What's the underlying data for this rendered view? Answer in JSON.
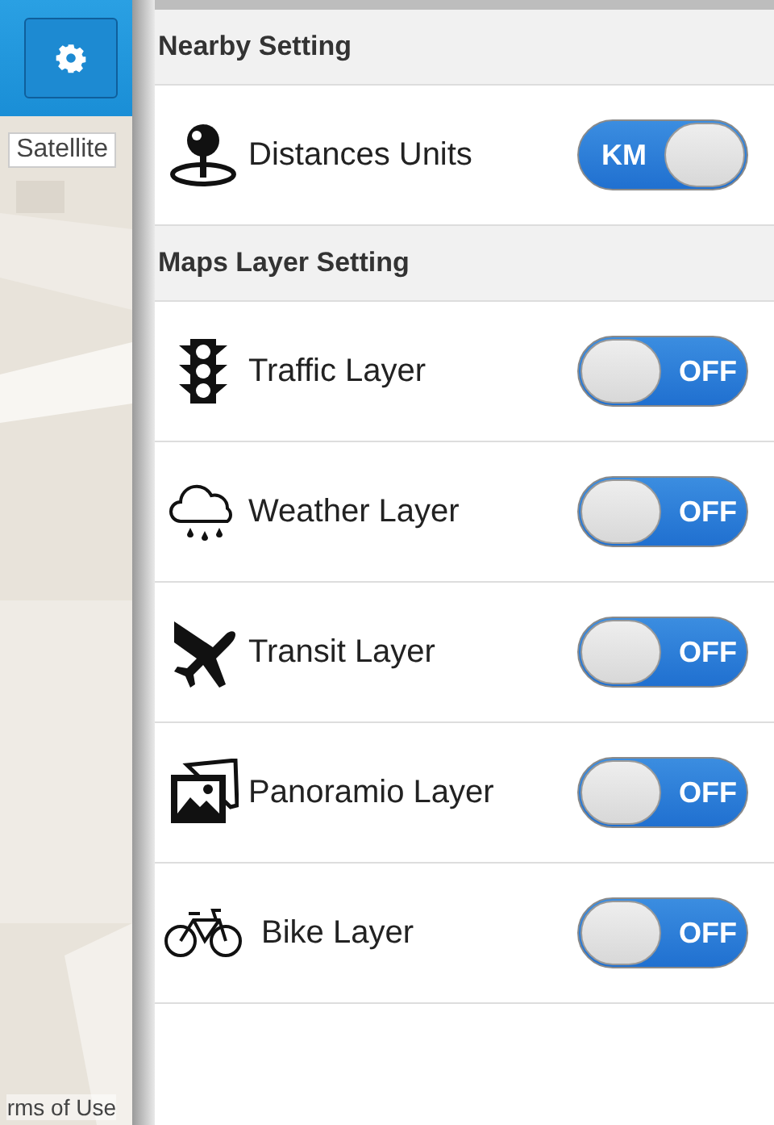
{
  "map": {
    "satellite_button": "Satellite",
    "terms_link": "rms of Use"
  },
  "sections": [
    {
      "title": "Nearby Setting",
      "rows": [
        {
          "label": "Distances Units",
          "toggle": {
            "on": true,
            "text": "KM"
          }
        }
      ]
    },
    {
      "title": "Maps Layer Setting",
      "rows": [
        {
          "label": "Traffic Layer",
          "toggle": {
            "on": false,
            "text": "OFF"
          }
        },
        {
          "label": "Weather Layer",
          "toggle": {
            "on": false,
            "text": "OFF"
          }
        },
        {
          "label": "Transit Layer",
          "toggle": {
            "on": false,
            "text": "OFF"
          }
        },
        {
          "label": "Panoramio Layer",
          "toggle": {
            "on": false,
            "text": "OFF"
          }
        },
        {
          "label": "Bike Layer",
          "toggle": {
            "on": false,
            "text": "OFF"
          }
        }
      ]
    }
  ]
}
